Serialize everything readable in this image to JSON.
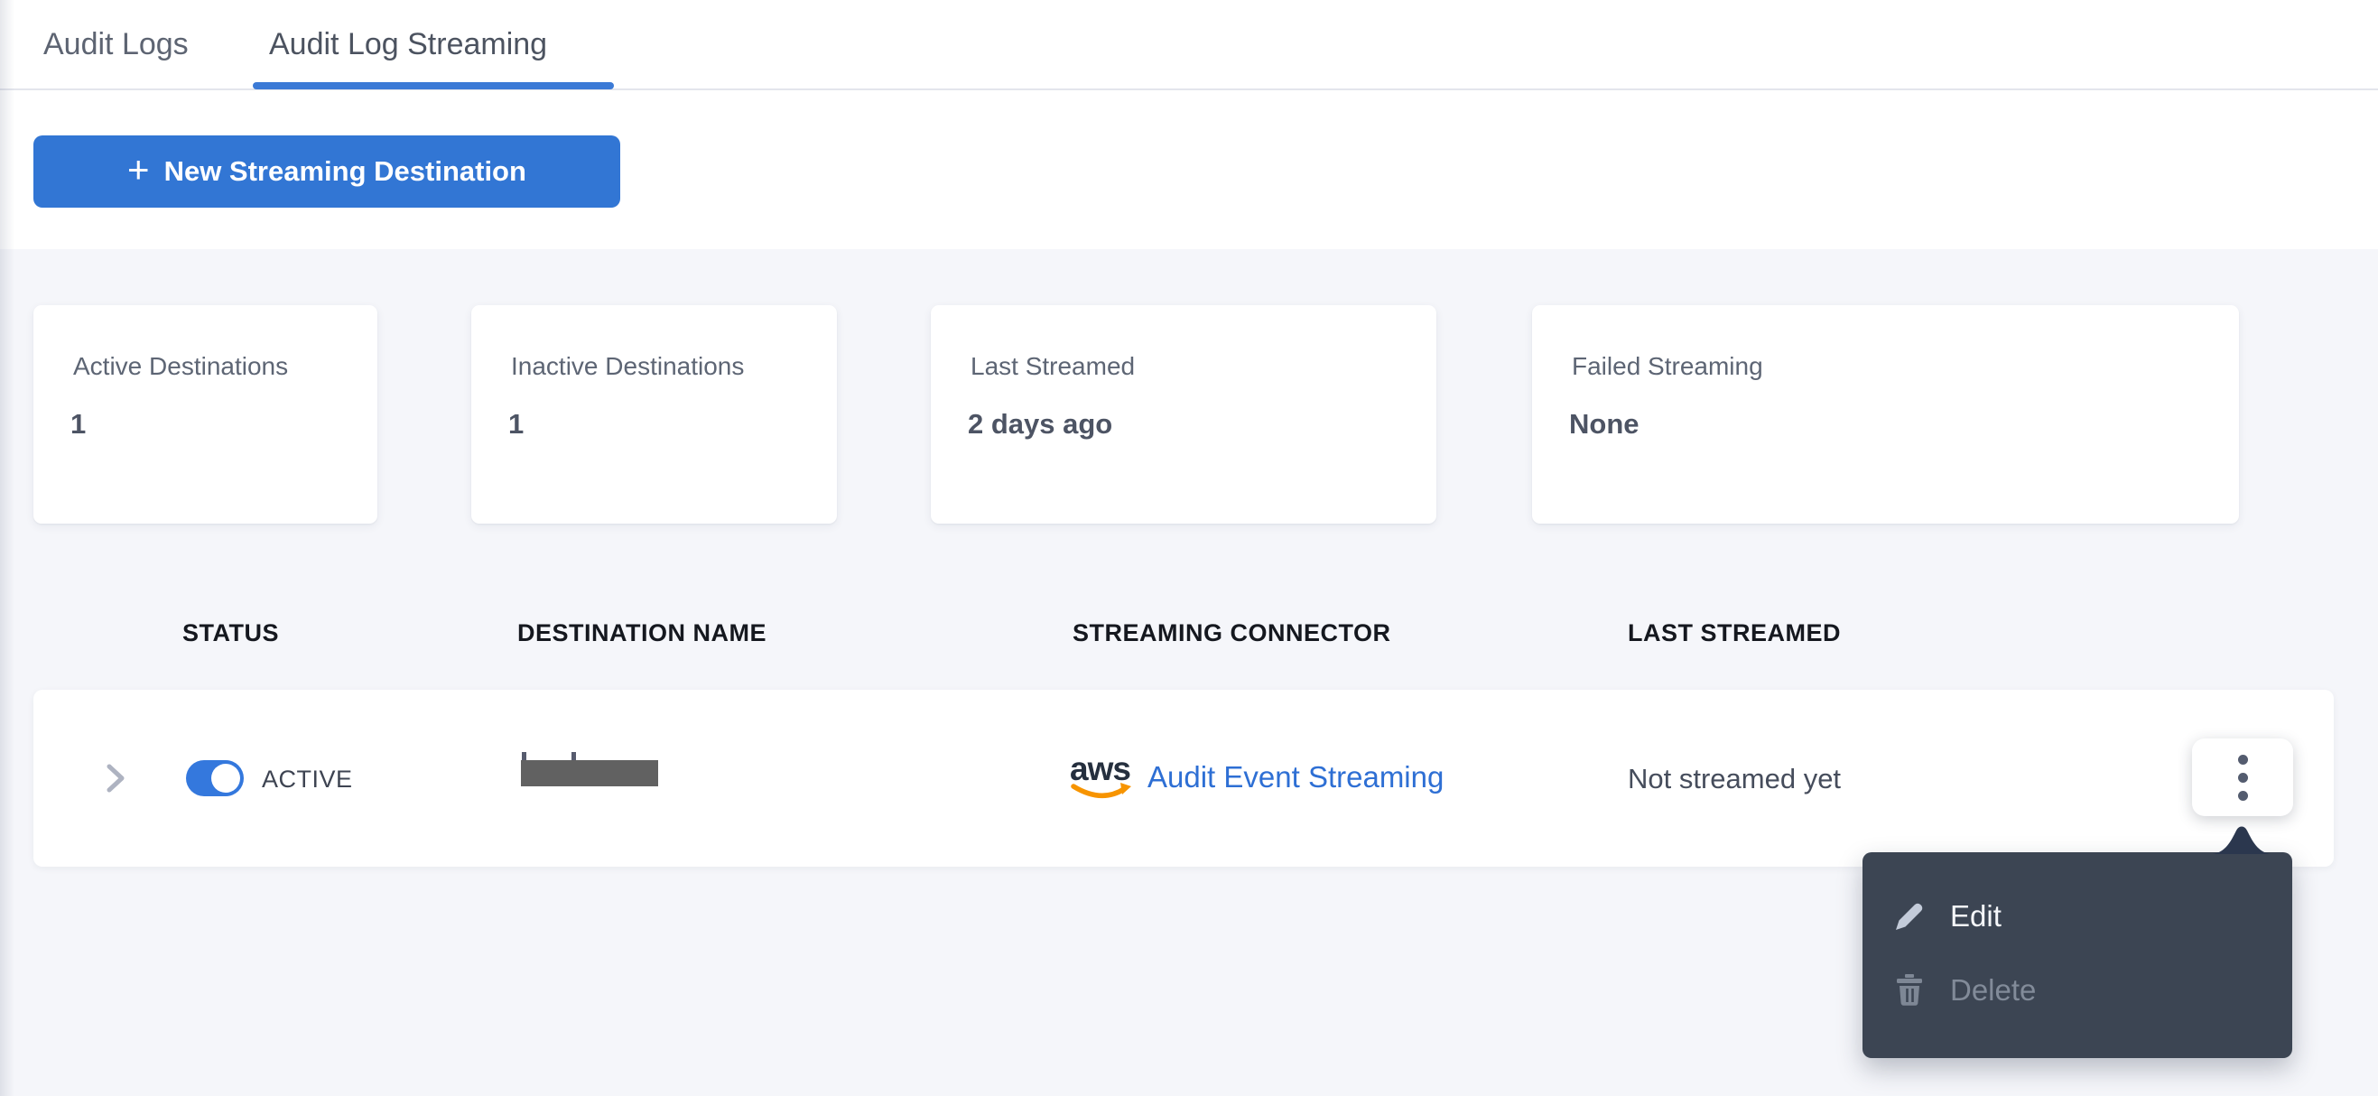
{
  "tabs": {
    "items": [
      {
        "label": "Audit Logs",
        "active": false
      },
      {
        "label": "Audit Log Streaming",
        "active": true
      }
    ]
  },
  "toolbar": {
    "new_destination": {
      "plus": "+",
      "label": "New Streaming Destination"
    }
  },
  "stats": {
    "cards": [
      {
        "label": "Active Destinations",
        "value": "1"
      },
      {
        "label": "Inactive Destinations",
        "value": "1"
      },
      {
        "label": "Last Streamed",
        "value": "2 days ago"
      },
      {
        "label": "Failed Streaming",
        "value": "None"
      }
    ]
  },
  "table": {
    "columns": [
      "STATUS",
      "DESTINATION NAME",
      "STREAMING CONNECTOR",
      "LAST STREAMED"
    ],
    "row": {
      "status_label": "ACTIVE",
      "status_on": true,
      "destination_name_redacted": true,
      "connector_provider": "aws",
      "connector_label": "Audit Event Streaming",
      "last_streamed": "Not streamed yet"
    }
  },
  "menu": {
    "items": [
      {
        "label": "Edit",
        "icon": "pencil-icon",
        "enabled": true
      },
      {
        "label": "Delete",
        "icon": "trash-icon",
        "enabled": false
      }
    ]
  },
  "colors": {
    "accent_blue": "#3276d4",
    "tab_underline_blue": "#3b7ad6",
    "link_blue": "#2e6fd4",
    "toggle_blue": "#3478dd",
    "menu_background": "#3c4553",
    "menu_arrow": "#2b374e",
    "page_background": "#f5f6fa",
    "aws_navy": "#252f3e",
    "aws_orange": "#f79400",
    "redaction_gray": "#616161"
  }
}
